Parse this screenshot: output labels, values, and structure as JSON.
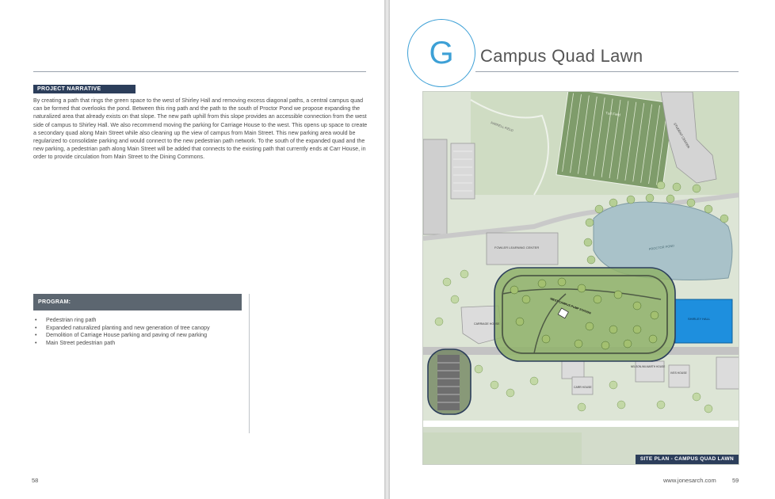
{
  "left_page": {
    "narrative_heading": "PROJECT NARRATIVE",
    "narrative_text": "By creating a path that rings the green space to the west of Shirley Hall and removing excess diagonal paths, a central campus quad can be formed that overlooks the pond. Between this ring path and the path to the south of Proctor Pond we propose expanding the naturalized area that already exists on that slope. The new path uphill from this slope provides an accessible connection from the west side of campus to Shirley Hall. We also recommend moving the parking for Carriage House to the west. This opens up space to create a secondary quad along Main Street while also cleaning up the view of campus from Main Street. This new parking area would be regularized to consolidate parking and would connect to the new pedestrian path network. To the south of the expanded quad and the new parking, a pedestrian path along Main Street will be added that connects to the existing path that currently ends at Carr House, in order to provide circulation from Main Street to the Dining Commons.",
    "program_heading": "PROGRAM:",
    "program_items": [
      "Pedestrian ring path",
      "Expanded naturalized planting and new generation of tree canopy",
      "Demolition of Carriage House parking and paving of new parking",
      "Main Street pedestrian path"
    ],
    "page_number": "58"
  },
  "right_page": {
    "section_letter": "G",
    "title": "Campus Quad Lawn",
    "map_labels": {
      "turf_field": "Turf Field",
      "farrell_field": "FARRELL FIELD",
      "student_center": "STUDENT CENTER",
      "fowler": "FOWLER LEARNING CENTER",
      "proctor_pond": "PROCTOR POND",
      "west_campus_pump_station": "WEST CAMPUS PUMP STATION",
      "carriage_house": "CARRIAGE HOUSE",
      "shirley_hall": "SHIRLEY HALL",
      "nelson_wilmarth": "NELSON-WILMARTH HOUSE",
      "ives_house": "IVES HOUSE",
      "carr_house": "CARR HOUSE"
    },
    "site_plan_label": "SITE PLAN - CAMPUS QUAD LAWN",
    "url": "www.jonesarch.com",
    "page_number": "59"
  },
  "colors": {
    "navy": "#2c3e5b",
    "program_bar": "#5c6670",
    "accent_blue": "#3da0d6",
    "shirley_hall_blue": "#1e8fde",
    "quad_green": "#8fb26a",
    "pond": "#a9c2c9"
  }
}
